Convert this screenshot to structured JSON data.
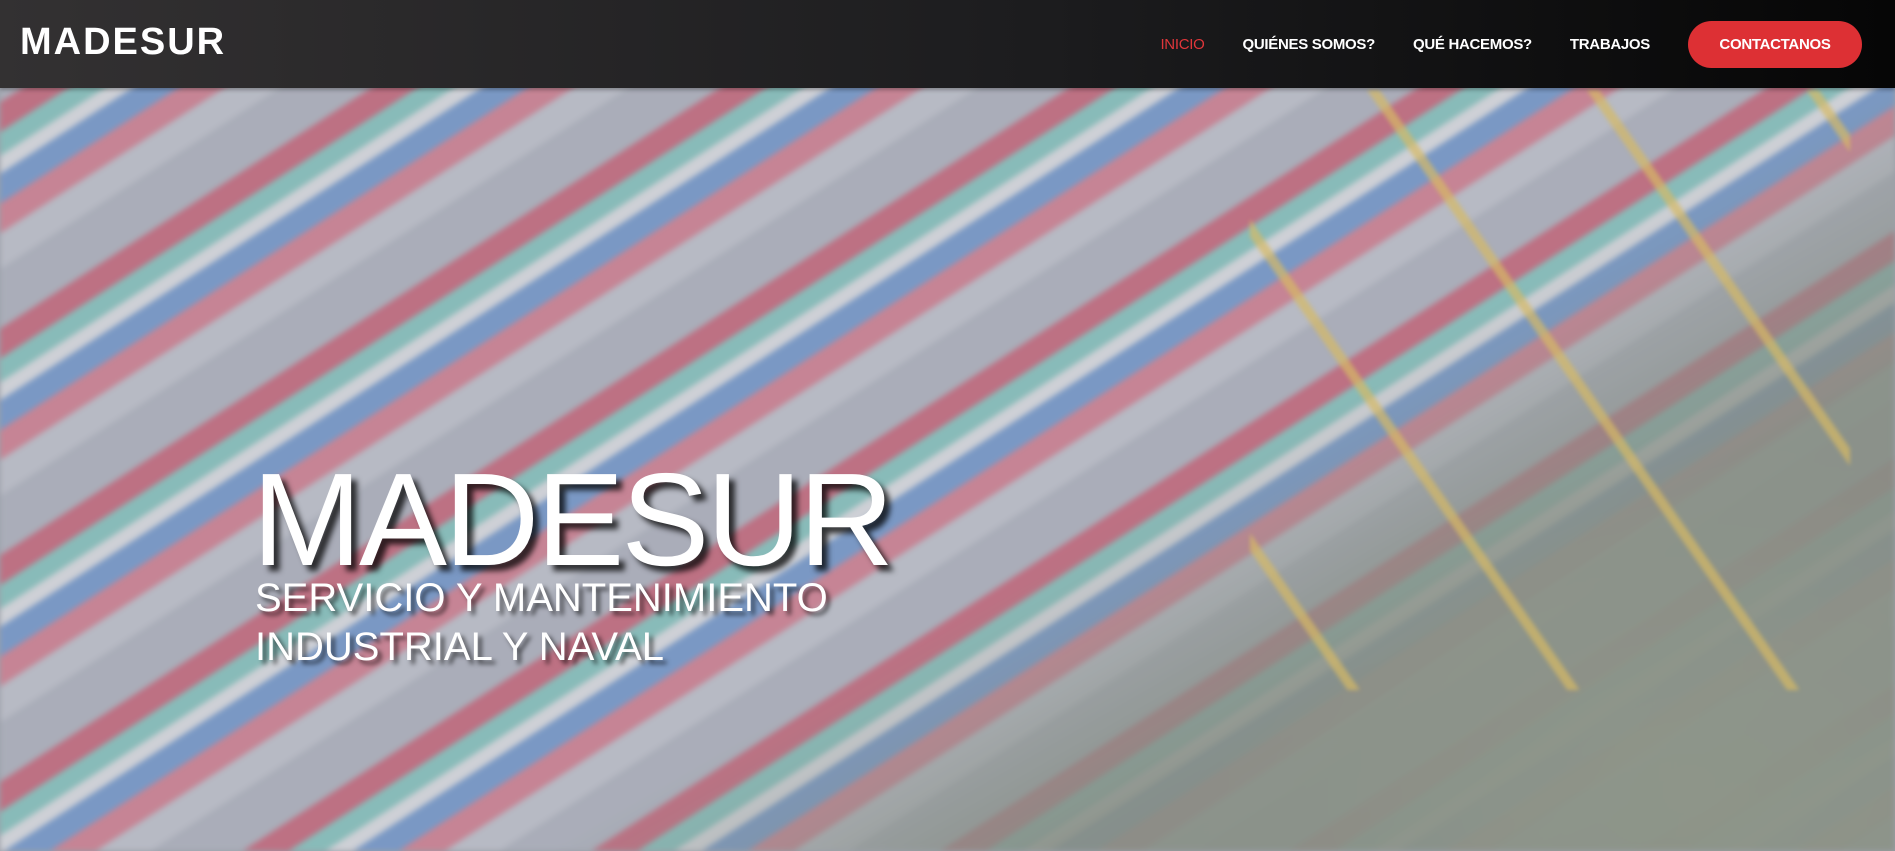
{
  "header": {
    "logo": "MADESUR",
    "nav": [
      {
        "label": "INICIO",
        "active": true
      },
      {
        "label": "QUIÉNES SOMOS?"
      },
      {
        "label": "QUÉ HACEMOS?"
      },
      {
        "label": "TRABAJOS"
      }
    ],
    "cta_label": "CONTACTANOS"
  },
  "hero": {
    "title": "MADESUR",
    "subtitle_line1": "SERVICIO Y MANTENIMIENTO",
    "subtitle_line2": "INDUSTRIAL Y NAVAL",
    "background": "aerial-container-port-image"
  },
  "colors": {
    "accent": "#dd3034",
    "header_bg": "#1c1c1e"
  }
}
